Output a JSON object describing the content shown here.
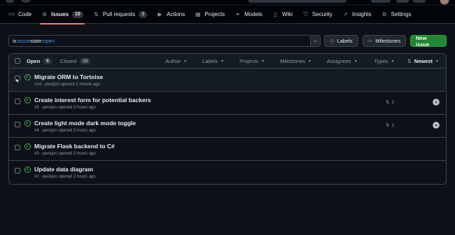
{
  "repo_tabs": [
    {
      "label": "Code",
      "icon": "code-icon",
      "glyph": "<>"
    },
    {
      "label": "Issues",
      "icon": "issue-opened-icon",
      "glyph": "⊙",
      "count": "10",
      "active": true
    },
    {
      "label": "Pull requests",
      "icon": "git-pull-request-icon",
      "glyph": "⇅",
      "count": "3"
    },
    {
      "label": "Actions",
      "icon": "play-icon",
      "glyph": "▶"
    },
    {
      "label": "Projects",
      "icon": "table-icon",
      "glyph": "▦"
    },
    {
      "label": "Models",
      "icon": "models-icon",
      "glyph": "⚭"
    },
    {
      "label": "Wiki",
      "icon": "book-icon",
      "glyph": "▯"
    },
    {
      "label": "Security",
      "icon": "shield-icon",
      "glyph": "⛉"
    },
    {
      "label": "Insights",
      "icon": "graph-icon",
      "glyph": "↗"
    },
    {
      "label": "Settings",
      "icon": "gear-icon",
      "glyph": "⚙"
    }
  ],
  "search": {
    "prefix1": "is:",
    "token1": "issue",
    "prefix2": " state:",
    "token2": "open"
  },
  "buttons": {
    "labels": "Labels",
    "milestones": "Milestones",
    "new_issue": "New issue"
  },
  "list_header": {
    "open_label": "Open",
    "open_count": "5",
    "closed_label": "Closed",
    "closed_count": "10",
    "filters": [
      "Author",
      "Labels",
      "Projects",
      "Milestones",
      "Assignees",
      "Types"
    ],
    "sort": "Newest"
  },
  "issues": [
    {
      "title": "Migrate ORM to Tortoise",
      "meta": "#14 · peckjon opened 1 minute ago",
      "prs": "",
      "assignee": false
    },
    {
      "title": "Create interest form for potential backers",
      "meta": "#5 · peckjon opened 2 hours ago",
      "prs": "1",
      "assignee": true
    },
    {
      "title": "Create light mode dark mode toggle",
      "meta": "#4 · peckjon opened 2 hours ago",
      "prs": "1",
      "assignee": true
    },
    {
      "title": "Migrate Flask backend to C#",
      "meta": "#3 · peckjon opened 2 hours ago",
      "prs": "",
      "assignee": false
    },
    {
      "title": "Update data diagram",
      "meta": "#2 · peckjon opened 2 hours ago",
      "prs": "",
      "assignee": false
    }
  ],
  "colors": {
    "background": "#0d1117",
    "open_green": "#3fb950",
    "new_issue_green": "#238636",
    "accent_blue": "#4493f8",
    "active_tab_underline": "#f78166"
  }
}
